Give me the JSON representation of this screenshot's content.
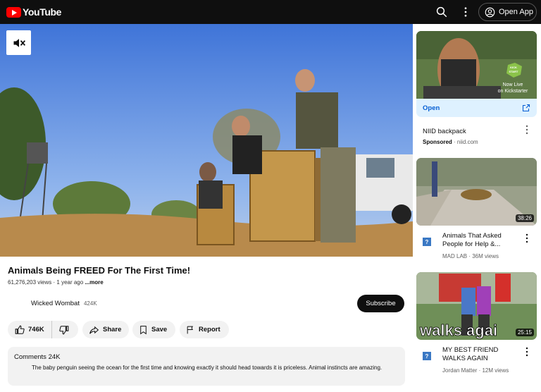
{
  "header": {
    "logo_text": "YouTube",
    "search_icon": "search-icon",
    "menu_icon": "more-vert-icon",
    "open_app_label": "Open App"
  },
  "video": {
    "title": "Animals Being FREED For The First Time!",
    "views": "61,276,203 views",
    "age": "1 year ago",
    "more_label": "...more",
    "mute_icon": "muted-speaker-icon"
  },
  "channel": {
    "name": "Wicked Wombat",
    "subscribers": "424K",
    "subscribe_label": "Subscribe"
  },
  "actions": {
    "likes": "746K",
    "share_label": "Share",
    "save_label": "Save",
    "report_label": "Report"
  },
  "comments": {
    "label": "Comments",
    "count": "24K",
    "top_comment": "The baby penguin seeing the ocean for the first time and knowing exactly it should head towards it is priceless. Animal instincts are amazing."
  },
  "sidebar": {
    "ad": {
      "badge_line1": "KICK",
      "badge_line2": "START",
      "overlay_line1": "Now Live",
      "overlay_line2": "on Kickstarter",
      "open_label": "Open",
      "title": "NIID backpack",
      "sponsored": "Sponsored",
      "domain": "niid.com"
    },
    "videos": [
      {
        "title": "Animals That Asked People for Help &...",
        "meta": "MAD LAB · 36M views",
        "duration": "38:26"
      },
      {
        "title": "MY BEST FRIEND WALKS AGAIN",
        "meta": "Jordan Matter · 12M views",
        "duration": "25:15",
        "thumb_text": "walks agai"
      }
    ]
  },
  "colors": {
    "brand_red": "#ff0000",
    "topbar": "#0f0f0f",
    "link_blue": "#065fd4"
  }
}
